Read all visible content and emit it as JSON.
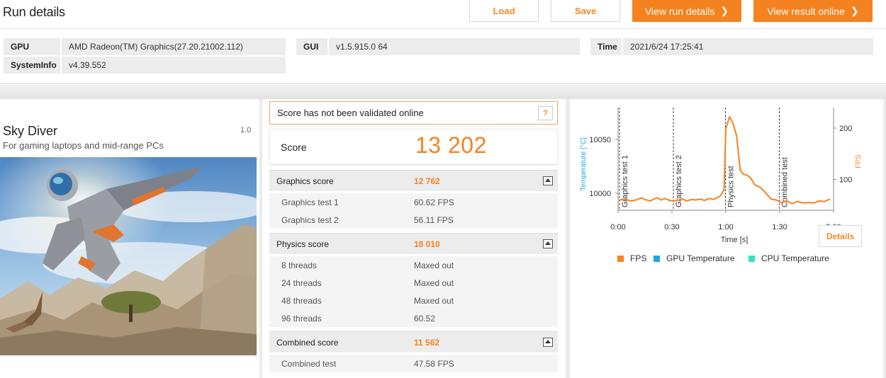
{
  "header": {
    "title": "Run details",
    "buttons": {
      "load": "Load",
      "save": "Save",
      "view_run": "View run details",
      "view_result": "View result online"
    }
  },
  "info": {
    "gpu_label": "GPU",
    "gpu_value": "AMD Radeon(TM) Graphics(27.20.21002.112)",
    "gui_label": "GUI",
    "gui_value": "v1.5.915.0 64",
    "time_label": "Time",
    "time_value": "2021/6/24 17:25:41",
    "sysinfo_label": "SystemInfo",
    "sysinfo_value": "v4.39.552"
  },
  "benchmark": {
    "name": "Sky Diver",
    "subtitle": "For gaming laptops and mid-range PCs",
    "version": "1.0"
  },
  "notice": {
    "text": "Score has not been validated online",
    "help": "?"
  },
  "score": {
    "label": "Score",
    "value": "13 202"
  },
  "sections": {
    "graphics": {
      "label": "Graphics score",
      "value": "12 762",
      "rows": [
        {
          "label": "Graphics test 1",
          "value": "60.62 FPS"
        },
        {
          "label": "Graphics test 2",
          "value": "56.11 FPS"
        }
      ]
    },
    "physics": {
      "label": "Physics score",
      "value": "18 010",
      "rows": [
        {
          "label": "8 threads",
          "value": "Maxed out"
        },
        {
          "label": "24 threads",
          "value": "Maxed out"
        },
        {
          "label": "48 threads",
          "value": "Maxed out"
        },
        {
          "label": "96 threads",
          "value": "60.52"
        }
      ]
    },
    "combined": {
      "label": "Combined score",
      "value": "11 562",
      "rows": [
        {
          "label": "Combined test",
          "value": "47.58 FPS"
        }
      ]
    }
  },
  "chart_data": {
    "type": "line",
    "xlabel": "Time [s]",
    "ylabel_left": "Temperature [°C]",
    "ylabel_right": "FPS",
    "x_ticks": [
      "0:00",
      "0:30",
      "1:00",
      "1:30",
      "2:00"
    ],
    "y_left_ticks": [
      "10000",
      "10050"
    ],
    "y_right_ticks": [
      "100",
      "200"
    ],
    "x_range": [
      0,
      120
    ],
    "y_right_range": [
      40,
      240
    ],
    "markers": [
      {
        "label": "Graphics test 1",
        "x": 0
      },
      {
        "label": "Graphics test 2",
        "x": 30
      },
      {
        "label": "Physics test",
        "x": 59
      },
      {
        "label": "Combined test",
        "x": 89
      }
    ],
    "series": [
      {
        "name": "FPS",
        "color": "#f58220",
        "x": [
          1,
          4,
          7,
          10,
          13,
          15,
          18,
          20,
          22,
          24,
          26,
          28,
          30,
          33,
          36,
          38,
          41,
          43,
          46,
          48,
          51,
          53,
          55,
          57,
          59,
          60,
          62,
          64,
          66,
          68,
          70,
          72,
          74,
          76,
          79,
          82,
          85,
          88,
          91,
          94,
          97,
          100,
          103,
          106,
          109,
          112,
          115,
          118
        ],
        "y": [
          60,
          62,
          58,
          60,
          64,
          61,
          58,
          62,
          64,
          60,
          63,
          60,
          58,
          59,
          62,
          58,
          61,
          60,
          62,
          59,
          63,
          61,
          64,
          68,
          80,
          198,
          222,
          210,
          185,
          118,
          110,
          108,
          102,
          90,
          85,
          75,
          62,
          60,
          55,
          58,
          53,
          57,
          54,
          55,
          54,
          58,
          57,
          62
        ]
      },
      {
        "name": "GPU Temperature",
        "color": "#1ba9e0"
      },
      {
        "name": "CPU Temperature",
        "color": "#2ee6c4"
      }
    ],
    "details_label": "Details"
  }
}
